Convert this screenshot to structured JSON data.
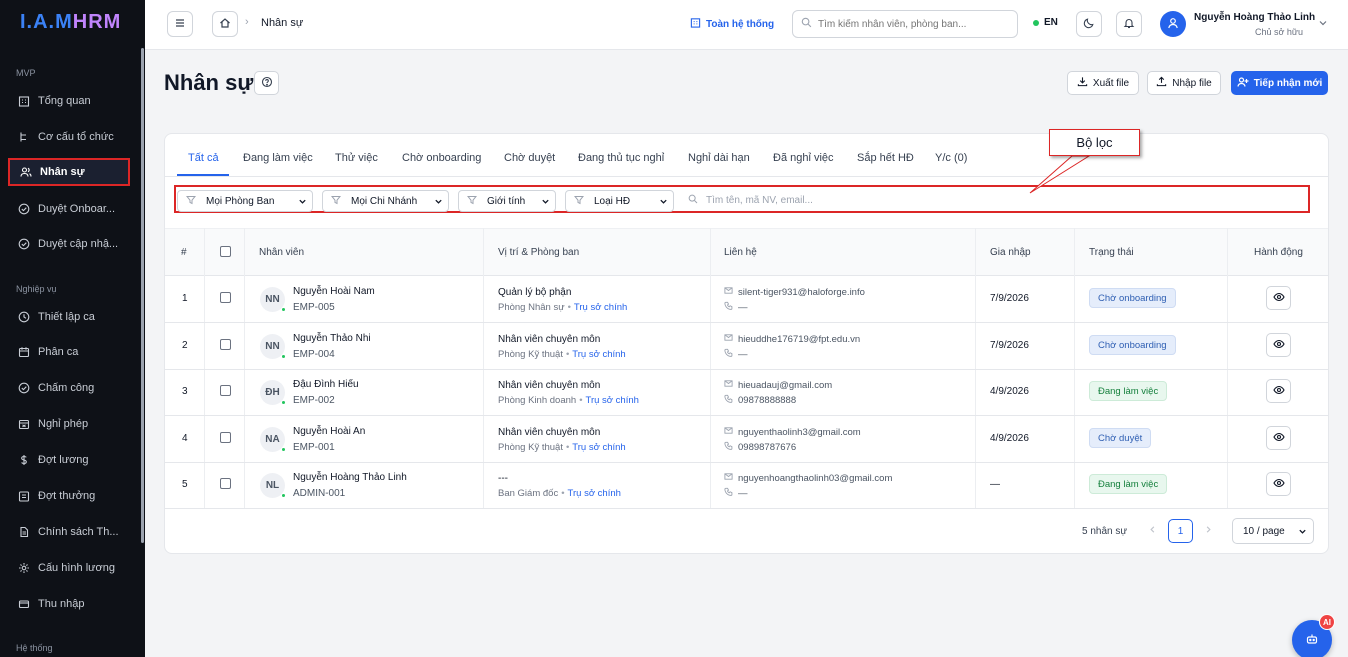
{
  "app": {
    "logo_main": "I.A.M",
    "logo_accent": "HRM"
  },
  "sidebar": {
    "sections": [
      {
        "label": "MVP"
      },
      {
        "label": "Nghiệp vụ"
      },
      {
        "label": "Hệ thống"
      }
    ],
    "items": [
      {
        "label": "Tổng quan",
        "icon": "building-icon"
      },
      {
        "label": "Cơ cấu tổ chức",
        "icon": "org-chart-icon"
      },
      {
        "label": "Nhân sự",
        "icon": "users-icon",
        "active": true
      },
      {
        "label": "Duyệt Onboar...",
        "icon": "check-circle-icon"
      },
      {
        "label": "Duyệt cập nhậ...",
        "icon": "check-circle-icon"
      },
      {
        "label": "Thiết lập ca",
        "icon": "clock-icon"
      },
      {
        "label": "Phân ca",
        "icon": "calendar-icon"
      },
      {
        "label": "Chấm công",
        "icon": "check-circle-icon"
      },
      {
        "label": "Nghỉ phép",
        "icon": "calendar-off-icon"
      },
      {
        "label": "Đợt lương",
        "icon": "dollar-icon"
      },
      {
        "label": "Đợt thưởng",
        "icon": "gift-icon"
      },
      {
        "label": "Chính sách Th...",
        "icon": "document-icon"
      },
      {
        "label": "Cấu hình lương",
        "icon": "gear-icon"
      },
      {
        "label": "Thu nhập",
        "icon": "wallet-icon"
      }
    ]
  },
  "topbar": {
    "breadcrumb": "Nhân sự",
    "system_link": "Toàn hệ thống",
    "search_placeholder": "Tìm kiếm nhân viên, phòng ban...",
    "language": "EN",
    "user_name": "Nguyễn Hoàng Thảo Linh",
    "user_role": "Chủ sở hữu"
  },
  "page": {
    "title": "Nhân sự",
    "export_label": "Xuất file",
    "import_label": "Nhập file",
    "onboard_label": "Tiếp nhận mới"
  },
  "tabs": [
    {
      "label": "Tất cả",
      "active": true
    },
    {
      "label": "Đang làm việc"
    },
    {
      "label": "Thử việc"
    },
    {
      "label": "Chờ onboarding"
    },
    {
      "label": "Chờ duyệt"
    },
    {
      "label": "Đang thủ tục nghỉ"
    },
    {
      "label": "Nghỉ dài hạn"
    },
    {
      "label": "Đã nghỉ việc"
    },
    {
      "label": "Sắp hết HĐ"
    },
    {
      "label": "Y/c (0)"
    }
  ],
  "filters": {
    "department": "Mọi Phòng Ban",
    "branch": "Mọi Chi Nhánh",
    "gender": "Giới tính",
    "contract": "Loại HĐ",
    "search_placeholder": "Tìm tên, mã NV, email..."
  },
  "annotation": {
    "label": "Bộ lọc"
  },
  "table": {
    "headers": [
      "#",
      "Nhân viên",
      "Vị trí & Phòng ban",
      "Liên hệ",
      "Gia nhập",
      "Trạng thái",
      "Hành động"
    ],
    "rows": [
      {
        "index": "1",
        "initials": "NN",
        "name": "Nguyễn Hoài Nam",
        "code": "EMP-005",
        "position": "Quản lý bộ phận",
        "department": "Phòng Nhân sự",
        "branch": "Trụ sở chính",
        "email": "silent-tiger931@haloforge.info",
        "phone": "—",
        "joined": "7/9/2026",
        "status": "Chờ onboarding",
        "status_color": "blue"
      },
      {
        "index": "2",
        "initials": "NN",
        "name": "Nguyễn Thảo Nhi",
        "code": "EMP-004",
        "position": "Nhân viên chuyên môn",
        "department": "Phòng Kỹ thuật",
        "branch": "Trụ sở chính",
        "email": "hieuddhe176719@fpt.edu.vn",
        "phone": "—",
        "joined": "7/9/2026",
        "status": "Chờ onboarding",
        "status_color": "blue"
      },
      {
        "index": "3",
        "initials": "ĐH",
        "name": "Đậu Đình Hiếu",
        "code": "EMP-002",
        "position": "Nhân viên chuyên môn",
        "department": "Phòng Kinh doanh",
        "branch": "Trụ sở chính",
        "email": "hieuadauj@gmail.com",
        "phone": "09878888888",
        "joined": "4/9/2026",
        "status": "Đang làm việc",
        "status_color": "green"
      },
      {
        "index": "4",
        "initials": "NA",
        "name": "Nguyễn Hoài An",
        "code": "EMP-001",
        "position": "Nhân viên chuyên môn",
        "department": "Phòng Kỹ thuật",
        "branch": "Trụ sở chính",
        "email": "nguyenthaolinh3@gmail.com",
        "phone": "09898787676",
        "joined": "4/9/2026",
        "status": "Chờ duyệt",
        "status_color": "blue"
      },
      {
        "index": "5",
        "initials": "NL",
        "name": "Nguyễn Hoàng Thảo Linh",
        "code": "ADMIN-001",
        "position": "---",
        "department": "Ban Giám đốc",
        "branch": "Trụ sở chính",
        "email": "nguyenhoangthaolinh03@gmail.com",
        "phone": "—",
        "joined": "—",
        "status": "Đang làm việc",
        "status_color": "green"
      }
    ]
  },
  "pagination": {
    "total": "5 nhân sự",
    "current_page": "1",
    "page_size": "10 / page"
  },
  "fab": {
    "badge": "AI"
  },
  "colors": {
    "primary": "#2563eb",
    "sidebar_bg": "#0e1117",
    "annotation": "#dc2626"
  }
}
